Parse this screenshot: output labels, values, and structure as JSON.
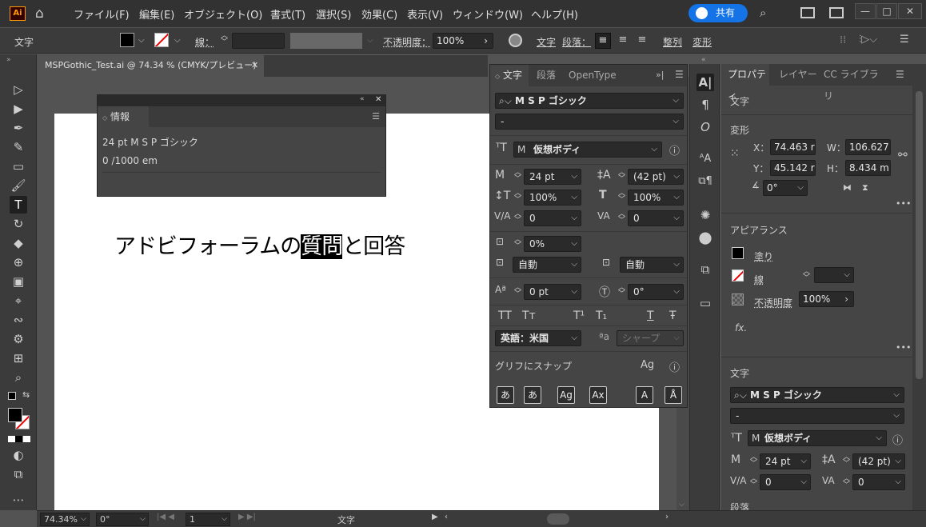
{
  "menubar": {
    "logo": "Ai",
    "items": [
      "ファイル(F)",
      "編集(E)",
      "オブジェクト(O)",
      "書式(T)",
      "選択(S)",
      "効果(C)",
      "表示(V)",
      "ウィンドウ(W)",
      "ヘルプ(H)"
    ],
    "share": "共有"
  },
  "control": {
    "tool_label": "文字",
    "stroke_label": "線：",
    "opacity_label": "不透明度：",
    "opacity_value": "100%",
    "char_label": "文字",
    "para_label": "段落：",
    "align_label": "整列",
    "transform_label": "変形"
  },
  "doc": {
    "tab_title": "MSPGothic_Test.ai @ 74.34 % (CMYK/プレビュー)",
    "text_before": "アドビフォーラムの",
    "text_selected": "質問",
    "text_after": "と回答"
  },
  "info": {
    "tab": "情報",
    "line1": "24 pt  M S  P ゴシック",
    "line2": "0 /1000 em"
  },
  "character": {
    "tabs": [
      "文字",
      "段落",
      "OpenType"
    ],
    "font_family": "M S  P ゴシック",
    "font_style": "-",
    "baseline_label": "仮想ボディ",
    "size": "24 pt",
    "leading": "(42 pt)",
    "vscale": "100%",
    "hscale": "100%",
    "kerning": "0",
    "tracking": "0",
    "tsume": "0%",
    "aki_before": "自動",
    "aki_after": "自動",
    "baseline_shift": "0 pt",
    "rotation": "0°",
    "caps_buttons": [
      "TT",
      "Tт",
      "T¹",
      "T₁",
      "T",
      "Ŧ"
    ],
    "language": "英語：米国",
    "antialias": "シャープ",
    "snap_label": "グリフにスナップ"
  },
  "properties": {
    "tabs": [
      "プロパティ",
      "レイヤー",
      "CC ライブラリ"
    ],
    "section_text": "文字",
    "section_transform": "変形",
    "x_label": "X：",
    "x": "74.463 r",
    "y_label": "Y：",
    "y": "45.142 r",
    "w_label": "W：",
    "w": "106.627",
    "h_label": "H：",
    "h": "8.434 m",
    "angle": "0°",
    "section_appearance": "アピアランス",
    "fill_label": "塗り",
    "stroke_label": "線",
    "opacity_label": "不透明度",
    "opacity_value": "100%",
    "fx": "fx.",
    "section_char": "文字",
    "font_family": "M S  P ゴシック",
    "font_style": "-",
    "baseline_label": "仮想ボディ",
    "size": "24 pt",
    "leading": "(42 pt)",
    "kerning": "0",
    "tracking": "0",
    "bottom_label": "段落"
  },
  "status": {
    "zoom": "74.34%",
    "angle": "0°",
    "artboard": "1",
    "tool": "文字"
  },
  "colors": {
    "accent": "#1473e6",
    "ui_dark": "#323232",
    "panel": "#454545"
  }
}
